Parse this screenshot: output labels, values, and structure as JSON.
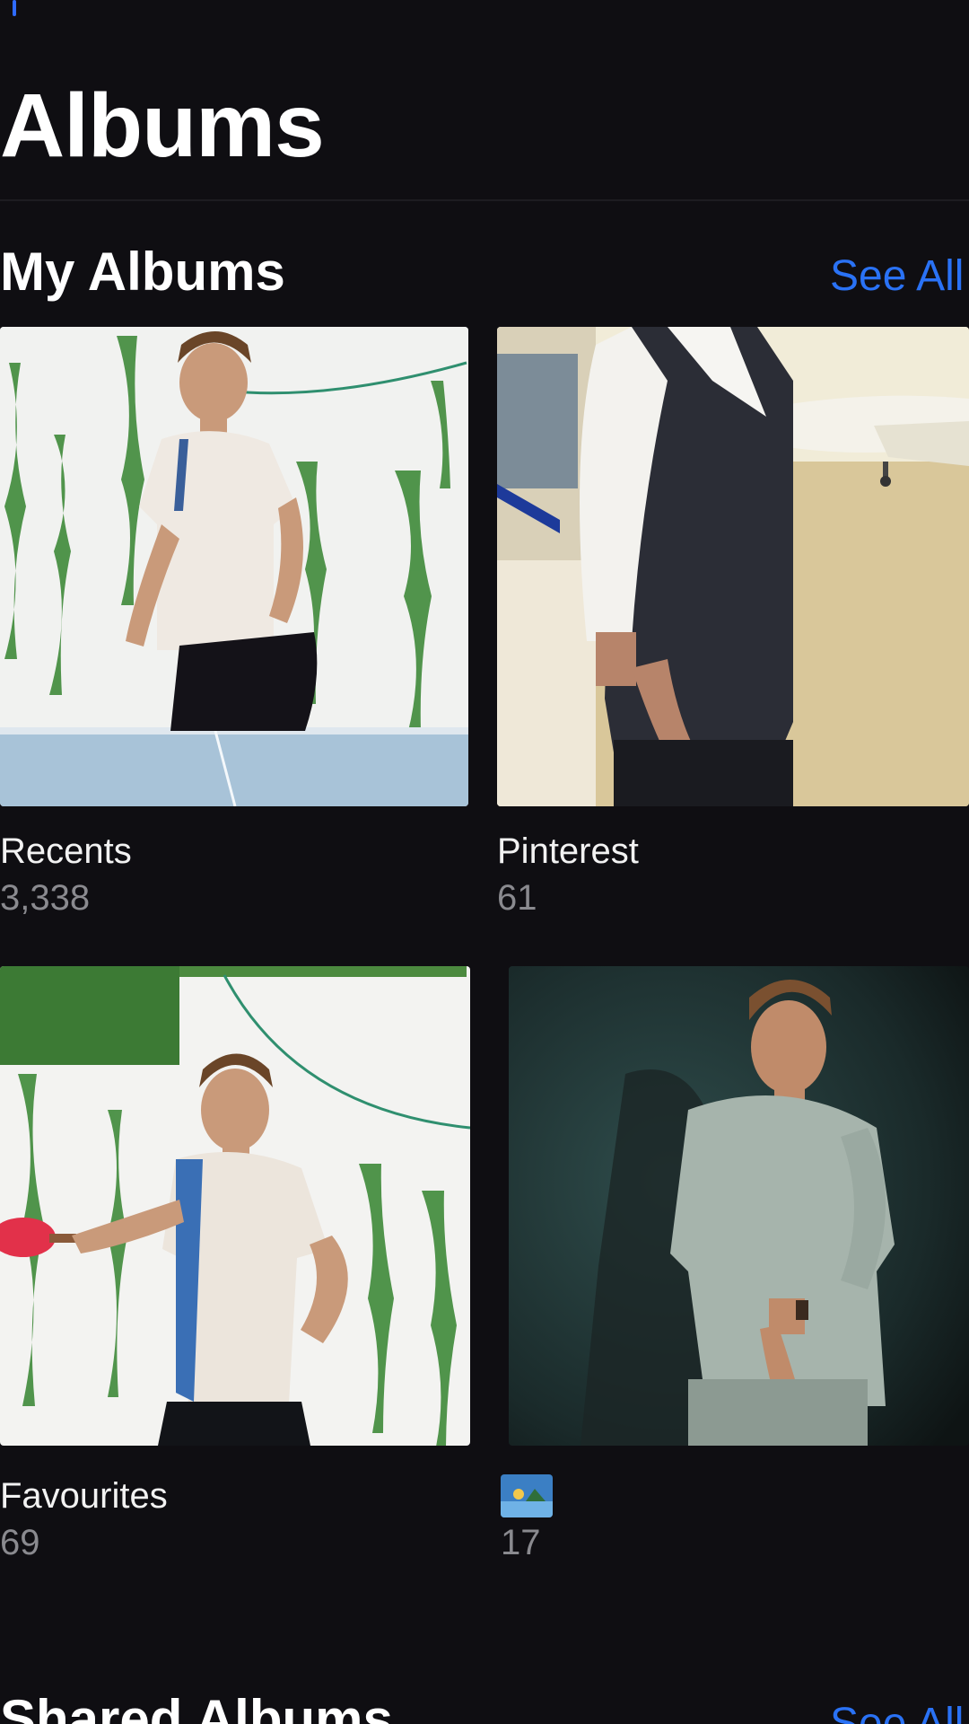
{
  "header": {
    "title": "Albums"
  },
  "my_albums": {
    "title": "My Albums",
    "see_all": "See All",
    "albums": [
      {
        "name": "Recents",
        "count": "3,338"
      },
      {
        "name": "Pinterest",
        "count": "61"
      },
      {
        "name": "Favourites",
        "count": "69"
      },
      {
        "name": "",
        "count": "17",
        "name_icon": "album-thumbnail-icon"
      }
    ]
  },
  "shared_albums": {
    "title": "Shared Albums",
    "see_all": "See All"
  },
  "colors": {
    "background": "#0f0e12",
    "accent": "#2a72f5",
    "secondary_text": "#8a8a8f"
  }
}
